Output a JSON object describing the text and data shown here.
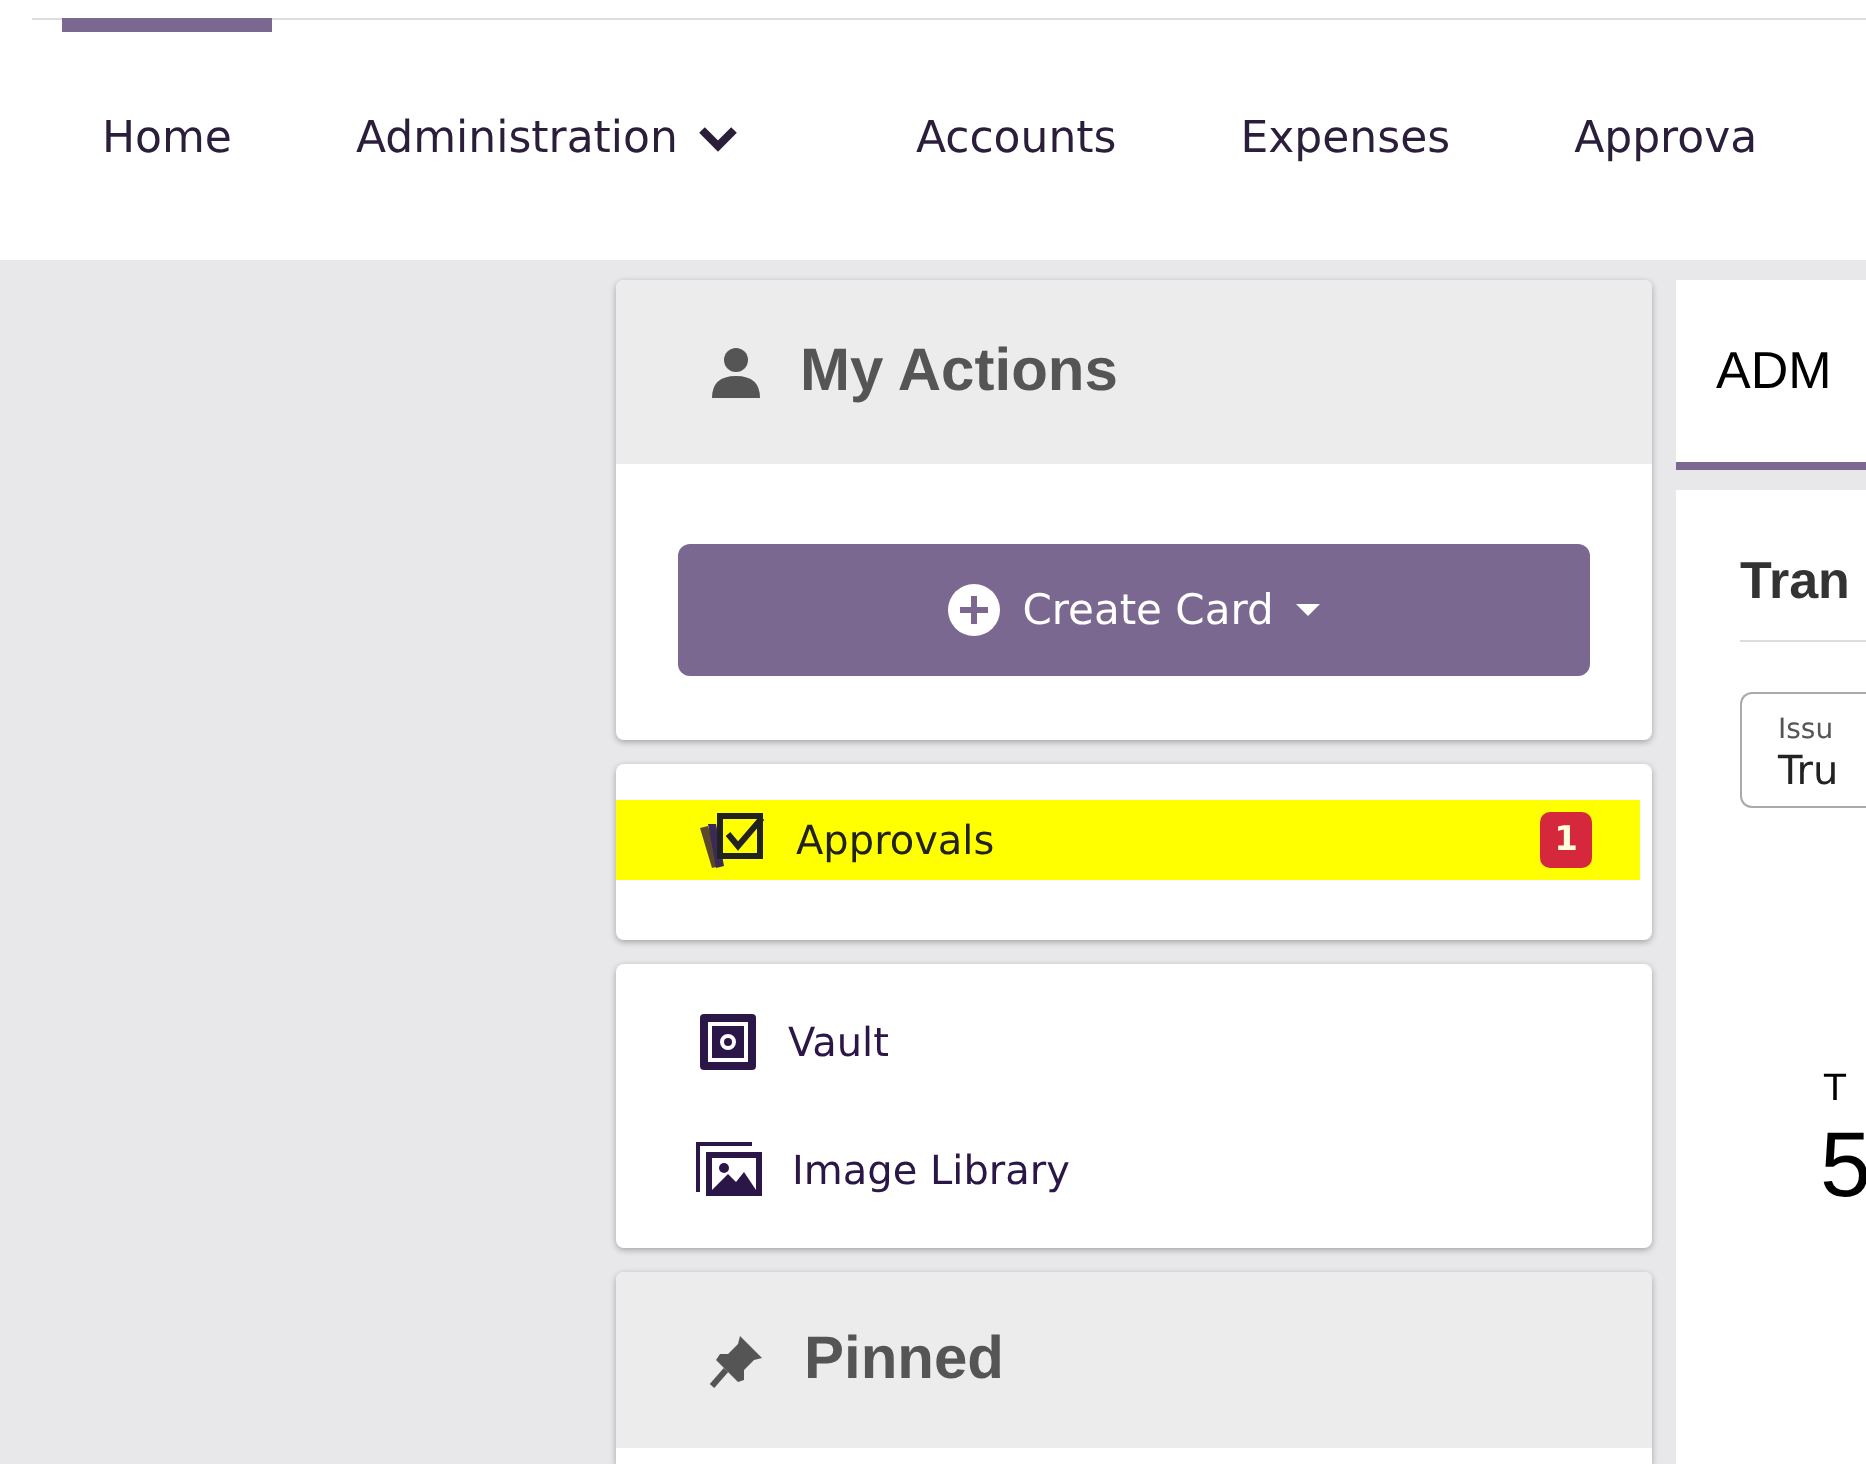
{
  "nav": {
    "items": [
      {
        "label": "Home",
        "selected": true,
        "dropdown": false
      },
      {
        "label": "Administration",
        "selected": false,
        "dropdown": true
      },
      {
        "label": "Accounts",
        "selected": false,
        "dropdown": false
      },
      {
        "label": "Expenses",
        "selected": false,
        "dropdown": false
      },
      {
        "label": "Approva",
        "selected": false,
        "dropdown": false
      }
    ]
  },
  "my_actions": {
    "title": "My Actions",
    "create_button": "Create Card"
  },
  "action_groups": [
    {
      "items": [
        {
          "kind": "approvals",
          "label": "Approvals",
          "badge": "1",
          "highlighted": true
        }
      ]
    },
    {
      "items": [
        {
          "kind": "vault",
          "label": "Vault",
          "highlighted": false
        },
        {
          "kind": "images",
          "label": "Image Library",
          "highlighted": false
        }
      ]
    }
  ],
  "pinned": {
    "title": "Pinned"
  },
  "right_panel": {
    "tab": "ADM",
    "heading": "Tran",
    "field": {
      "label": "Issu",
      "value": "Tru"
    },
    "stat_label": "T",
    "stat_value": "5"
  }
}
